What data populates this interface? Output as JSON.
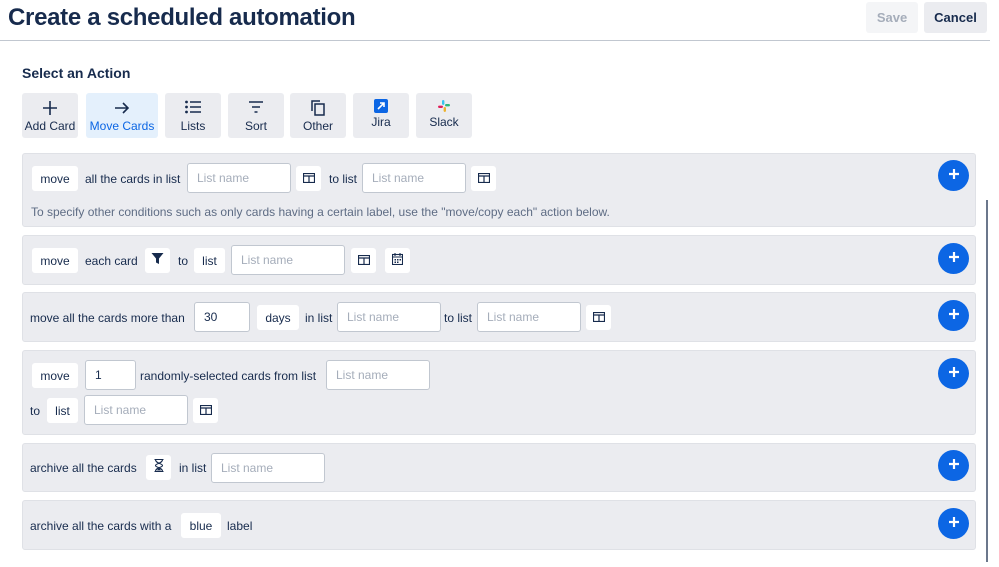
{
  "header": {
    "title": "Create a scheduled automation",
    "save_label": "Save",
    "cancel_label": "Cancel"
  },
  "section_title": "Select an Action",
  "tabs": [
    {
      "label": "Add Card",
      "icon": "plus-icon"
    },
    {
      "label": "Move Cards",
      "icon": "arrow-right-icon"
    },
    {
      "label": "Lists",
      "icon": "list-icon"
    },
    {
      "label": "Sort",
      "icon": "sort-icon"
    },
    {
      "label": "Other",
      "icon": "copy-icon"
    },
    {
      "label": "Jira",
      "icon": "jira-icon"
    },
    {
      "label": "Slack",
      "icon": "slack-icon"
    }
  ],
  "active_tab": "Move Cards",
  "rows": {
    "r1": {
      "move": "move",
      "text1": "all the cards in list",
      "placeholder": "List name",
      "text2": "to list",
      "note": "To specify other conditions such as only cards having a certain label, use the \"move/copy each\" action below."
    },
    "r2": {
      "move": "move",
      "text1": "each card",
      "to": "to",
      "list": "list",
      "placeholder": "List name"
    },
    "r3": {
      "text1": "move all the cards more than",
      "value": "30",
      "unit": "days",
      "text2": "in list",
      "text3": "to list",
      "placeholder": "List name"
    },
    "r4": {
      "move": "move",
      "value": "1",
      "text1": "randomly-selected cards from list",
      "placeholder": "List name",
      "to": "to",
      "list": "list"
    },
    "r5": {
      "text1": "archive all the cards",
      "text2": "in list",
      "placeholder": "List name"
    },
    "r6": {
      "text1": "archive all the cards with a",
      "color": "blue",
      "text2": "label"
    }
  },
  "colors": {
    "accent": "#0c66e4",
    "card_bg": "#ebecf0",
    "text": "#172b4d"
  }
}
